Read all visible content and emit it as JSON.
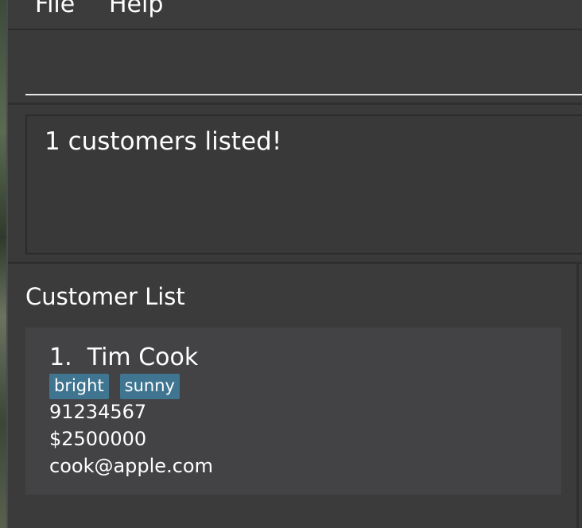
{
  "menu": {
    "file": "File",
    "help": "Help"
  },
  "command": {
    "value": "",
    "placeholder": ""
  },
  "result": {
    "message": "1 customers listed!"
  },
  "customer_list": {
    "title": "Customer List",
    "items": [
      {
        "name": "1.  Tim Cook",
        "tags": [
          "bright",
          "sunny"
        ],
        "phone": "91234567",
        "value": "$2500000",
        "email": "cook@apple.com"
      }
    ]
  }
}
